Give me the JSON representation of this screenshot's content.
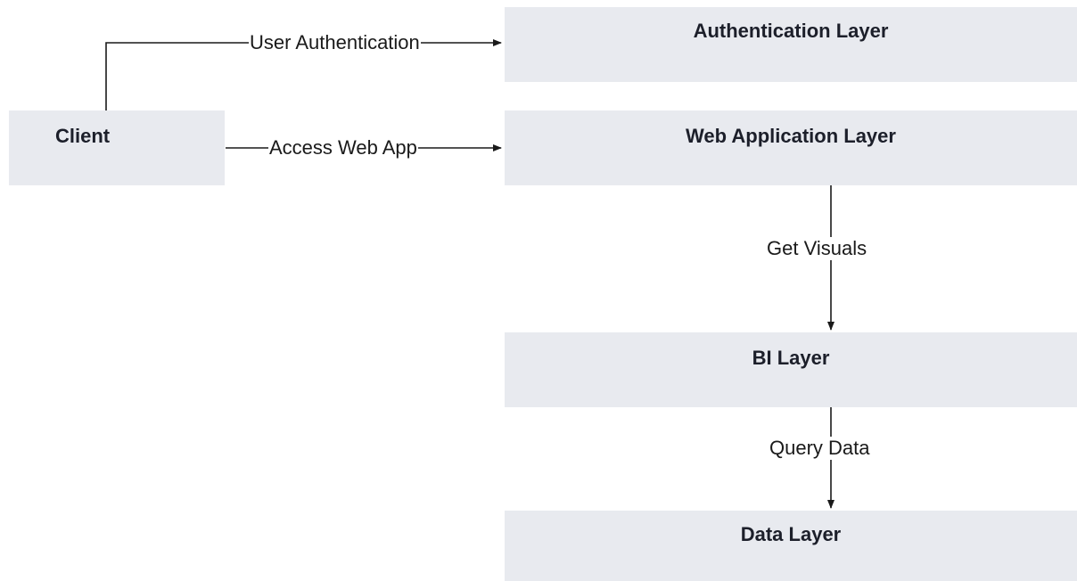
{
  "nodes": {
    "client": "Client",
    "authentication_layer": "Authentication Layer",
    "web_application_layer": "Web Application Layer",
    "bi_layer": "BI Layer",
    "data_layer": "Data Layer"
  },
  "edges": {
    "user_authentication": "User Authentication",
    "access_web_app": "Access Web App",
    "get_visuals": "Get Visuals",
    "query_data": "Query Data"
  },
  "colors": {
    "box_fill": "#e8eaef",
    "line": "#1a1a1a",
    "background": "#ffffff"
  }
}
